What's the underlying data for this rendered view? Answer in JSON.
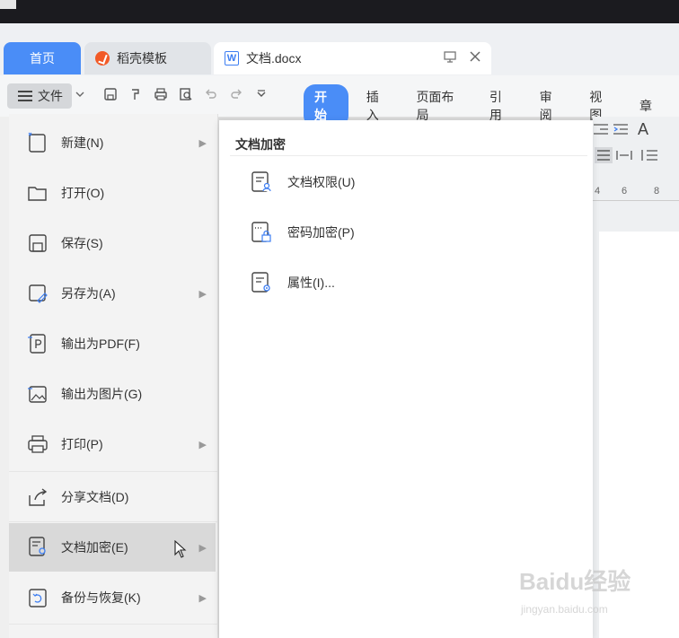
{
  "tabs": {
    "home": "首页",
    "template": "稻壳模板",
    "doc": "文档.docx"
  },
  "toolbar": {
    "file_label": "文件",
    "ribbon_tabs": [
      "开始",
      "插入",
      "页面布局",
      "引用",
      "审阅",
      "视图",
      "章"
    ]
  },
  "ruler": [
    "4",
    "6",
    "8"
  ],
  "menu": {
    "items": [
      {
        "label": "新建(N)",
        "icon": "new-doc-icon",
        "arrow": true
      },
      {
        "label": "打开(O)",
        "icon": "folder-icon",
        "arrow": false
      },
      {
        "label": "保存(S)",
        "icon": "save-icon",
        "arrow": false
      },
      {
        "label": "另存为(A)",
        "icon": "save-as-icon",
        "arrow": true
      },
      {
        "label": "输出为PDF(F)",
        "icon": "pdf-icon",
        "arrow": false
      },
      {
        "label": "输出为图片(G)",
        "icon": "image-icon",
        "arrow": false
      },
      {
        "label": "打印(P)",
        "icon": "printer-icon",
        "arrow": true
      },
      {
        "label": "分享文档(D)",
        "icon": "share-icon",
        "arrow": false
      },
      {
        "label": "文档加密(E)",
        "icon": "encrypt-icon",
        "arrow": true
      },
      {
        "label": "备份与恢复(K)",
        "icon": "backup-icon",
        "arrow": true
      }
    ]
  },
  "submenu": {
    "title": "文档加密",
    "items": [
      {
        "label": "文档权限(U)",
        "icon": "doc-permission-icon"
      },
      {
        "label": "密码加密(P)",
        "icon": "password-lock-icon"
      },
      {
        "label": "属性(I)...",
        "icon": "properties-icon"
      }
    ]
  },
  "colors": {
    "accent": "#4a8df7",
    "brand_orange": "#f25a27",
    "highlight": "#d9d9d9"
  },
  "watermark": {
    "brand": "Baidu经验",
    "url": "jingyan.baidu.com"
  }
}
